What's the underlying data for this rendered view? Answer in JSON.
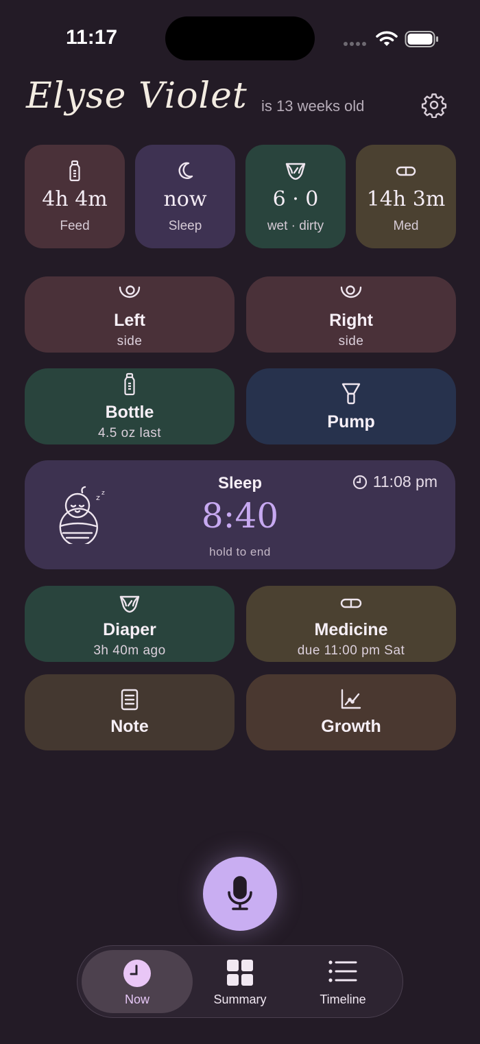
{
  "status_bar": {
    "time": "11:17"
  },
  "header": {
    "baby_name": "Elyse Violet",
    "age_text": "is 13 weeks old"
  },
  "stats": [
    {
      "value": "4h 4m",
      "label": "Feed",
      "icon": "bottle-icon"
    },
    {
      "value": "now",
      "label": "Sleep",
      "icon": "moon-icon"
    },
    {
      "value": "6 · 0",
      "label": "wet · dirty",
      "icon": "diaper-icon"
    },
    {
      "value": "14h 3m",
      "label": "Med",
      "icon": "pill-icon"
    }
  ],
  "actions": {
    "left": {
      "title": "Left",
      "subtitle": "side"
    },
    "right": {
      "title": "Right",
      "subtitle": "side"
    },
    "bottle": {
      "title": "Bottle",
      "subtitle": "4.5 oz last"
    },
    "pump": {
      "title": "Pump"
    },
    "diaper": {
      "title": "Diaper",
      "subtitle": "3h 40m ago"
    },
    "medicine": {
      "title": "Medicine",
      "subtitle": "due 11:00 pm Sat"
    },
    "note": {
      "title": "Note"
    },
    "growth": {
      "title": "Growth"
    }
  },
  "sleep_card": {
    "title": "Sleep",
    "timer": "8:40",
    "hint": "hold to end",
    "start_time": "11:08 pm"
  },
  "tabs": [
    {
      "label": "Now",
      "active": true
    },
    {
      "label": "Summary",
      "active": false
    },
    {
      "label": "Timeline",
      "active": false
    }
  ],
  "colors": {
    "background": "#231b26",
    "accent": "#c9aef2",
    "feed": "#4a3139",
    "sleep": "#3e3252",
    "diaper": "#29443d",
    "medicine": "#4b4131",
    "pump": "#27324d",
    "note": "#443830",
    "growth": "#4a3830"
  }
}
